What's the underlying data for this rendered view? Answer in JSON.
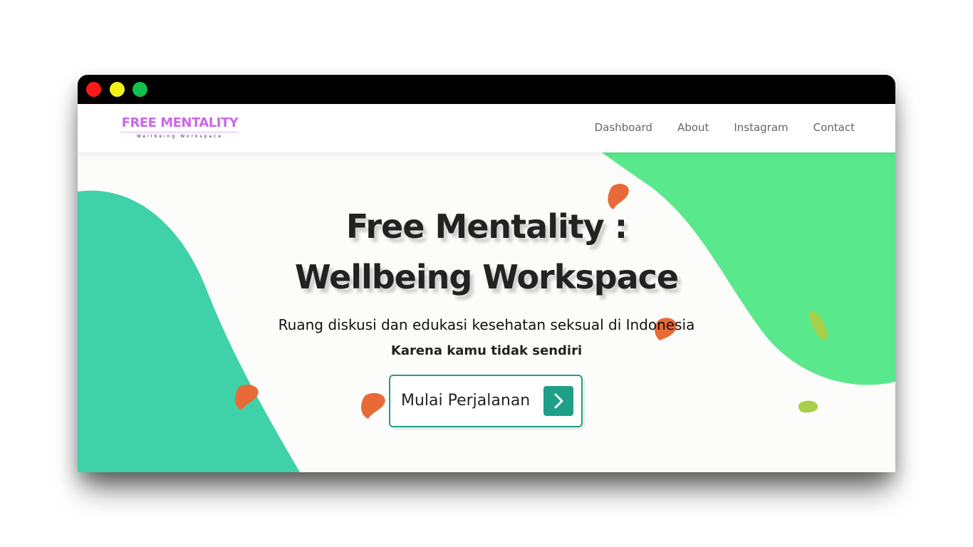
{
  "window": {
    "controls": [
      "close",
      "minimize",
      "maximize"
    ]
  },
  "navbar": {
    "logo_title": "FREE MENTALITY",
    "logo_subtitle": "Wellbeing Workspace",
    "links": [
      {
        "label": "Dashboard"
      },
      {
        "label": "About"
      },
      {
        "label": "Instagram"
      },
      {
        "label": "Contact"
      }
    ]
  },
  "hero": {
    "title_line1": "Free Mentality :",
    "title_line2": "Wellbeing Workspace",
    "tagline": "Ruang diskusi dan edukasi kesehatan seksual di Indonesia",
    "subtagline": "Karena kamu tidak sendiri",
    "cta_label": "Mulai Perjalanan",
    "cta_icon": "chevron-right-icon"
  },
  "colors": {
    "logo": "#c968e8",
    "teal_blob": "#3fd1a8",
    "green_blob": "#5ae88d",
    "orange_blob": "#e86a36",
    "lime_blob": "#a6cf4a",
    "cta_accent": "#1f9f88"
  }
}
